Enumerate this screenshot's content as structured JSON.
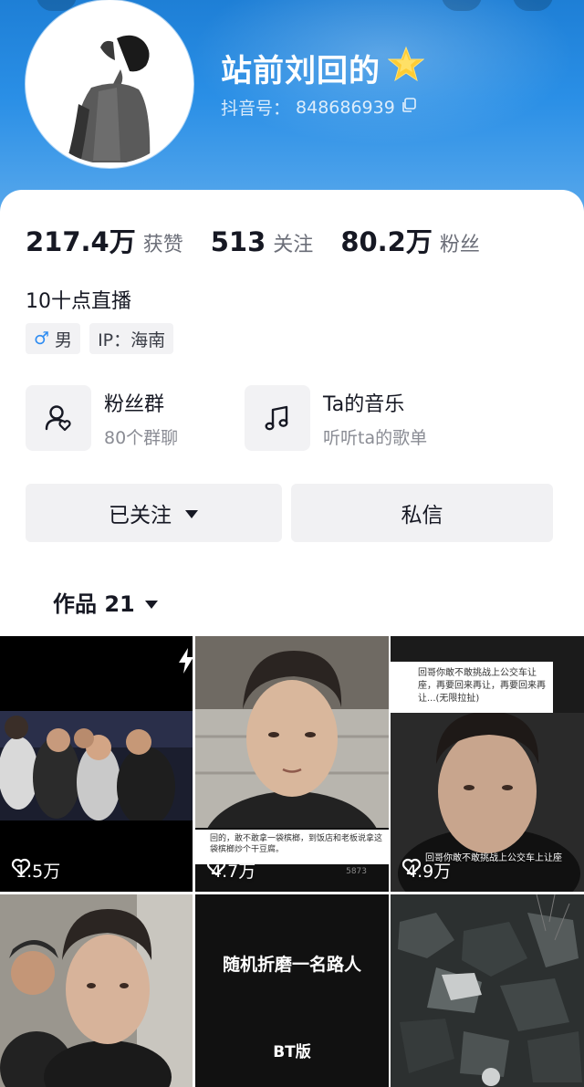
{
  "profile": {
    "nickname": "站前刘回的",
    "nickname_emoji": "🌟",
    "douyin_id_label": "抖音号：",
    "douyin_id": "848686939"
  },
  "stats": [
    {
      "value": "217.4万",
      "label": "获赞"
    },
    {
      "value": "513",
      "label": "关注"
    },
    {
      "value": "80.2万",
      "label": "粉丝"
    }
  ],
  "bio": "10十点直播",
  "tags": {
    "gender_symbol": "♂",
    "gender": "男",
    "ip": "IP：海南"
  },
  "entries": [
    {
      "title": "粉丝群",
      "subtitle": "80个群聊",
      "icon": "fan-group-icon"
    },
    {
      "title": "Ta的音乐",
      "subtitle": "听听ta的歌单",
      "icon": "music-note-icon"
    }
  ],
  "buttons": {
    "followed": "已关注",
    "message": "私信"
  },
  "works_tab": {
    "label": "作品 21"
  },
  "videos": [
    {
      "likes": "1.5万"
    },
    {
      "likes": "4.7万",
      "caption": "回的，敢不敢拿一袋槟榔，到饭店和老板说拿这袋槟榔炒个干豆腐。",
      "caption_count": "5873"
    },
    {
      "likes": "4.9万",
      "caption": "回哥你敢不敢挑战上公交车让座，再要回来再让，再要回来再让...(无限拉扯)",
      "subcaption": "回哥你敢不敢挑战上公交车上让座"
    },
    {
      "likes": ""
    },
    {
      "likes": "",
      "title": "随机折磨一名路人",
      "subtitle": "BT版"
    },
    {
      "likes": ""
    }
  ],
  "colors": {
    "header_blue": "#1e7fd6",
    "button_bg": "#f1f1f3",
    "male_blue": "#2f8df2"
  }
}
